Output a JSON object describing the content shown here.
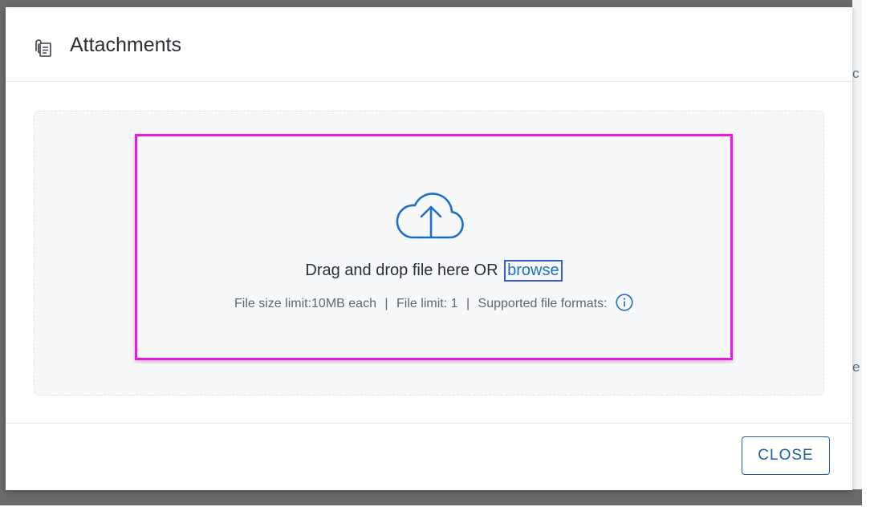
{
  "dialog": {
    "title": "Attachments",
    "icon": "attachment-document-icon"
  },
  "upload": {
    "icon": "cloud-upload-icon",
    "drag_text": "Drag and drop file here OR",
    "browse_label": "browse",
    "size_limit": "File size limit:10MB each",
    "separator": "|",
    "file_limit": "File limit: 1",
    "formats_label": "Supported file formats:",
    "info_icon": "info-icon"
  },
  "footer": {
    "close_label": "CLOSE"
  },
  "colors": {
    "accent": "#1f6fc8",
    "highlight_border": "#f017e6",
    "browse_focus": "#3b5bd1",
    "close_border": "#1f5fa8"
  }
}
